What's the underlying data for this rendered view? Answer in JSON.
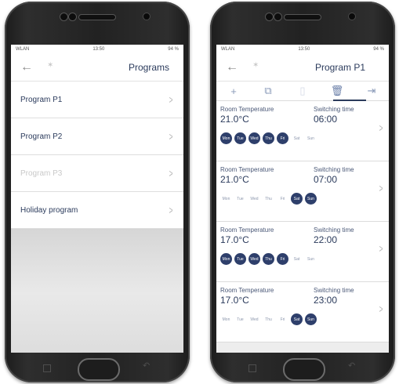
{
  "left_phone": {
    "status": {
      "carrier": "WLAN",
      "time": "13:50",
      "battery": "94 %"
    },
    "title": "Programs",
    "items": [
      {
        "label": "Program P1",
        "disabled": false
      },
      {
        "label": "Program P2",
        "disabled": false
      },
      {
        "label": "Program P3",
        "disabled": true
      },
      {
        "label": "Holiday program",
        "disabled": false
      }
    ]
  },
  "right_phone": {
    "status": {
      "carrier": "WLAN",
      "time": "13:50",
      "battery": "94 %"
    },
    "title": "Program P1",
    "toolbar": {
      "add": "+",
      "copy": "⧉",
      "paste": "▯",
      "delete": "🗑",
      "export": "⇥"
    },
    "cards": [
      {
        "temp_label": "Room Temperature",
        "temp": "21.0°C",
        "time_label": "Switching time",
        "time": "06:00",
        "days": [
          "Mon",
          "Tue",
          "Wed",
          "Thu",
          "Fri",
          "Sat",
          "Sun"
        ],
        "active": [
          true,
          true,
          true,
          true,
          true,
          false,
          false
        ]
      },
      {
        "temp_label": "Room Temperature",
        "temp": "21.0°C",
        "time_label": "Switching time",
        "time": "07:00",
        "days": [
          "Mon",
          "Tue",
          "Wed",
          "Thu",
          "Fri",
          "Sat",
          "Sun"
        ],
        "active": [
          false,
          false,
          false,
          false,
          false,
          true,
          true
        ]
      },
      {
        "temp_label": "Room Temperature",
        "temp": "17.0°C",
        "time_label": "Switching time",
        "time": "22:00",
        "days": [
          "Mon",
          "Tue",
          "Wed",
          "Thu",
          "Fri",
          "Sat",
          "Sun"
        ],
        "active": [
          true,
          true,
          true,
          true,
          true,
          false,
          false
        ]
      },
      {
        "temp_label": "Room Temperature",
        "temp": "17.0°C",
        "time_label": "Switching time",
        "time": "23:00",
        "days": [
          "Mon",
          "Tue",
          "Wed",
          "Thu",
          "Fri",
          "Sat",
          "Sun"
        ],
        "active": [
          false,
          false,
          false,
          false,
          false,
          true,
          true
        ]
      }
    ]
  },
  "colors": {
    "primary": "#2e3f6b",
    "text": "#2b3b5c"
  },
  "icons": {
    "back": "arrow-left-icon",
    "bluetooth": "bluetooth-icon",
    "chevron": "chevron-right-icon"
  }
}
